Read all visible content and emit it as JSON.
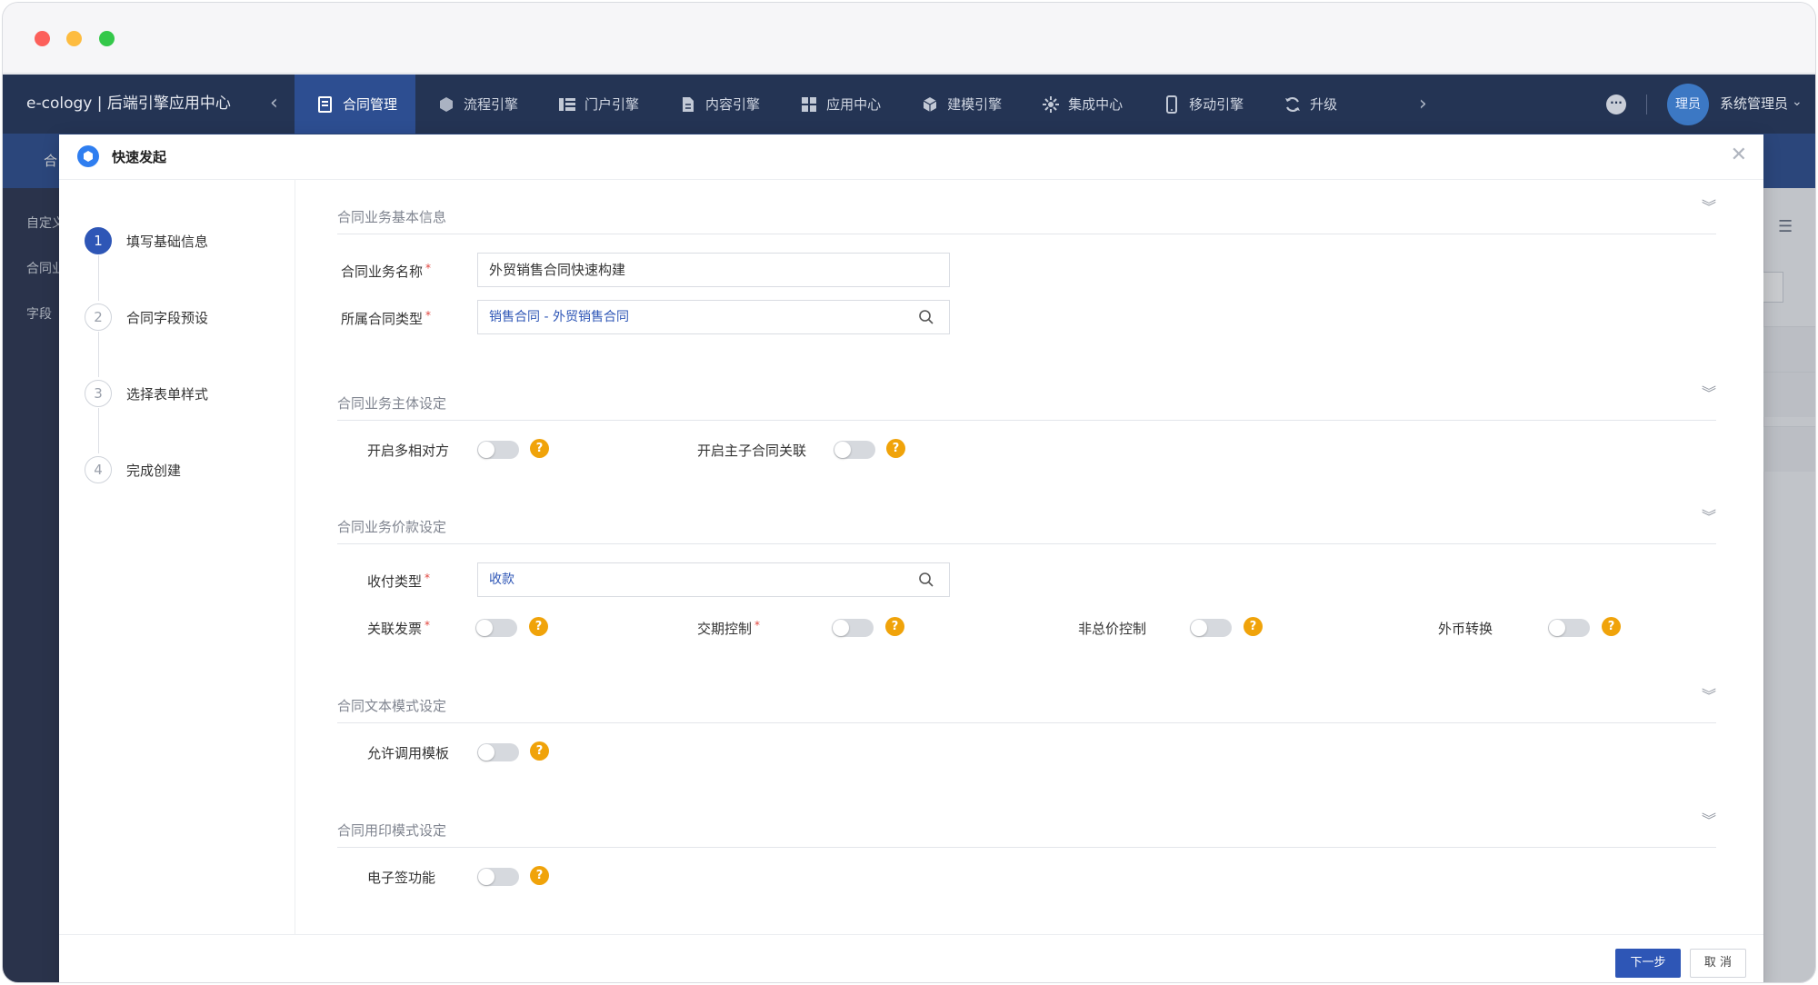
{
  "app": {
    "brand": "e-cology | 后端引擎应用中心",
    "nav": [
      {
        "label": "合同管理",
        "icon": "contract-icon",
        "active": true
      },
      {
        "label": "流程引擎",
        "icon": "workflow-icon",
        "active": false
      },
      {
        "label": "门户引擎",
        "icon": "portal-icon",
        "active": false
      },
      {
        "label": "内容引擎",
        "icon": "document-icon",
        "active": false
      },
      {
        "label": "应用中心",
        "icon": "apps-icon",
        "active": false
      },
      {
        "label": "建模引擎",
        "icon": "cube-icon",
        "active": false
      },
      {
        "label": "集成中心",
        "icon": "integration-icon",
        "active": false
      },
      {
        "label": "移动引擎",
        "icon": "mobile-icon",
        "active": false
      },
      {
        "label": "升级",
        "icon": "refresh-icon",
        "active": false
      }
    ],
    "user": {
      "avatar_text": "理员",
      "name": "系统管理员"
    }
  },
  "background": {
    "subbar_text": "合",
    "sidebar_items": [
      "自定义",
      "合同业",
      "字段"
    ]
  },
  "modal": {
    "title": "快速发起",
    "steps": [
      {
        "num": "1",
        "label": "填写基础信息",
        "active": true
      },
      {
        "num": "2",
        "label": "合同字段预设",
        "active": false
      },
      {
        "num": "3",
        "label": "选择表单样式",
        "active": false
      },
      {
        "num": "4",
        "label": "完成创建",
        "active": false
      }
    ],
    "sections": {
      "basic": {
        "title": "合同业务基本信息",
        "name_label": "合同业务名称",
        "name_value": "外贸销售合同快速构建",
        "type_label": "所属合同类型",
        "type_value": "销售合同 - 外贸销售合同"
      },
      "subject": {
        "title": "合同业务主体设定",
        "multi_party_label": "开启多相对方",
        "sub_contract_label": "开启主子合同关联"
      },
      "price": {
        "title": "合同业务价款设定",
        "pay_type_label": "收付类型",
        "pay_type_value": "收款",
        "invoice_label": "关联发票",
        "delivery_label": "交期控制",
        "non_total_label": "非总价控制",
        "fx_label": "外币转换"
      },
      "text": {
        "title": "合同文本模式设定",
        "template_label": "允许调用模板"
      },
      "seal": {
        "title": "合同用印模式设定",
        "esign_label": "电子签功能"
      }
    },
    "footer": {
      "next": "下一步",
      "cancel": "取 消"
    }
  },
  "colors": {
    "nav_bg": "#243454",
    "accent": "#2e56b6",
    "help": "#f0a30a"
  }
}
